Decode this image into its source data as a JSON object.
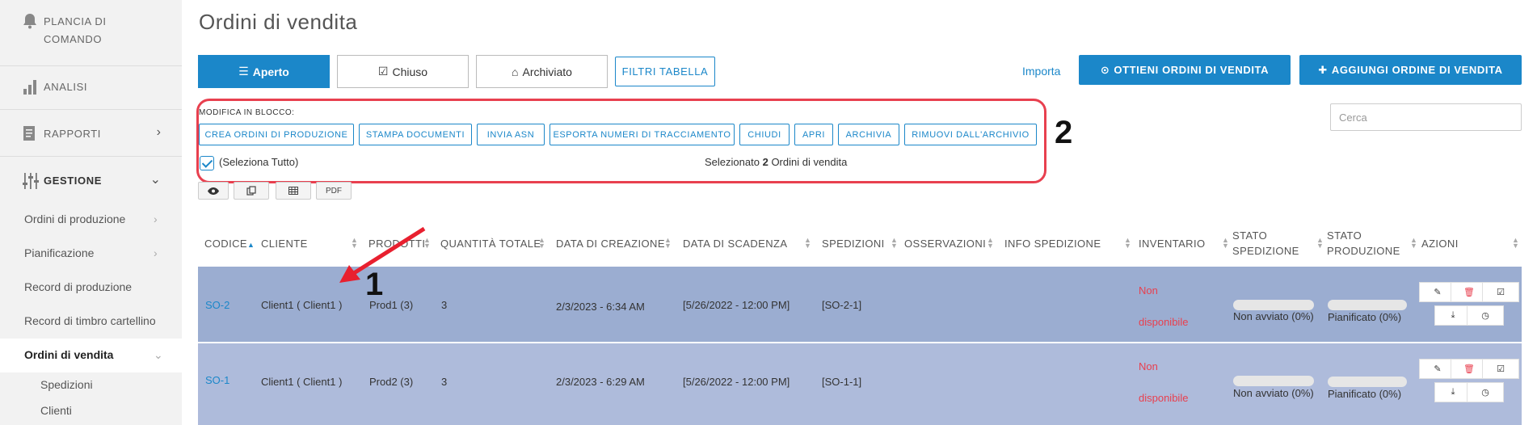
{
  "sidebar": {
    "dashboard": "PLANCIA DI COMANDO",
    "analytics": "ANALISI",
    "reports": "RAPPORTI",
    "management": "GESTIONE",
    "items": [
      "Ordini di produzione",
      "Pianificazione",
      "Record di produzione",
      "Record di timbro cartellino",
      "Ordini di vendita"
    ],
    "subitems": [
      "Spedizioni",
      "Clienti"
    ]
  },
  "page": {
    "title": "Ordini di vendita"
  },
  "tabs": [
    {
      "label": "Aperto",
      "icon": "list-icon"
    },
    {
      "label": "Chiuso",
      "icon": "check-square-icon"
    },
    {
      "label": "Archiviato",
      "icon": "inbox-icon"
    }
  ],
  "filters_button": "FILTRI TABELLA",
  "import_link": "Importa",
  "get_orders_button": "OTTIENI ORDINI DI VENDITA",
  "add_order_button": "AGGIUNGI ORDINE DI VENDITA",
  "bulk": {
    "label": "MODIFICA IN BLOCCO:",
    "buttons": [
      "CREA ORDINI DI PRODUZIONE",
      "STAMPA DOCUMENTI",
      "INVIA ASN",
      "ESPORTA NUMERI DI TRACCIAMENTO",
      "CHIUDI",
      "APRI",
      "ARCHIVIA",
      "RIMUOVI DALL'ARCHIVIO"
    ]
  },
  "select_all": "(Seleziona Tutto)",
  "selection": {
    "prefix": "Selezionato",
    "count": "2",
    "suffix": "Ordini di vendita"
  },
  "view_buttons": {
    "eye": "eye-icon",
    "copy": "copy-icon",
    "table": "table-icon",
    "pdf": "PDF"
  },
  "search": {
    "placeholder": "Cerca"
  },
  "annotations": {
    "one": "1",
    "two": "2"
  },
  "table": {
    "headers": {
      "code": "CODICE",
      "client": "CLIENTE",
      "products": "PRODOTTI",
      "total_qty": "QUANTITÀ TOTALE",
      "created": "DATA DI CREAZIONE",
      "due": "DATA DI SCADENZA",
      "shipments": "SPEDIZIONI",
      "notes": "OSSERVAZIONI",
      "ship_info": "INFO SPEDIZIONE",
      "inventory": "INVENTARIO",
      "ship_status_1": "STATO",
      "ship_status_2": "SPEDIZIONE",
      "prod_status_1": "STATO",
      "prod_status_2": "PRODUZIONE",
      "actions": "AZIONI"
    },
    "rows": [
      {
        "code": "SO-2",
        "client": "Client1 ( Client1 )",
        "products": "Prod1 (3)",
        "qty": "3",
        "created": "2/3/2023 - 6:34 AM",
        "due": "[5/26/2022 - 12:00 PM]",
        "shipments": "[SO-2-1]",
        "inventory_1": "Non",
        "inventory_2": "disponibile",
        "ship_status": "Non avviato (0%)",
        "ship_progress": 0,
        "prod_status": "Pianificato (0%)",
        "prod_progress": 0
      },
      {
        "code": "SO-1",
        "client": "Client1 ( Client1 )",
        "products": "Prod2 (3)",
        "qty": "3",
        "created": "2/3/2023 - 6:29 AM",
        "due": "[5/26/2022 - 12:00 PM]",
        "shipments": "[SO-1-1]",
        "inventory_1": "Non",
        "inventory_2": "disponibile",
        "ship_status": "Non avviato (0%)",
        "ship_progress": 0,
        "prod_status": "Pianificato (0%)",
        "prod_progress": 0
      }
    ]
  },
  "colors": {
    "accent": "#1b87c9",
    "highlight": "#e8404f",
    "row_selected": "#9badd1"
  }
}
